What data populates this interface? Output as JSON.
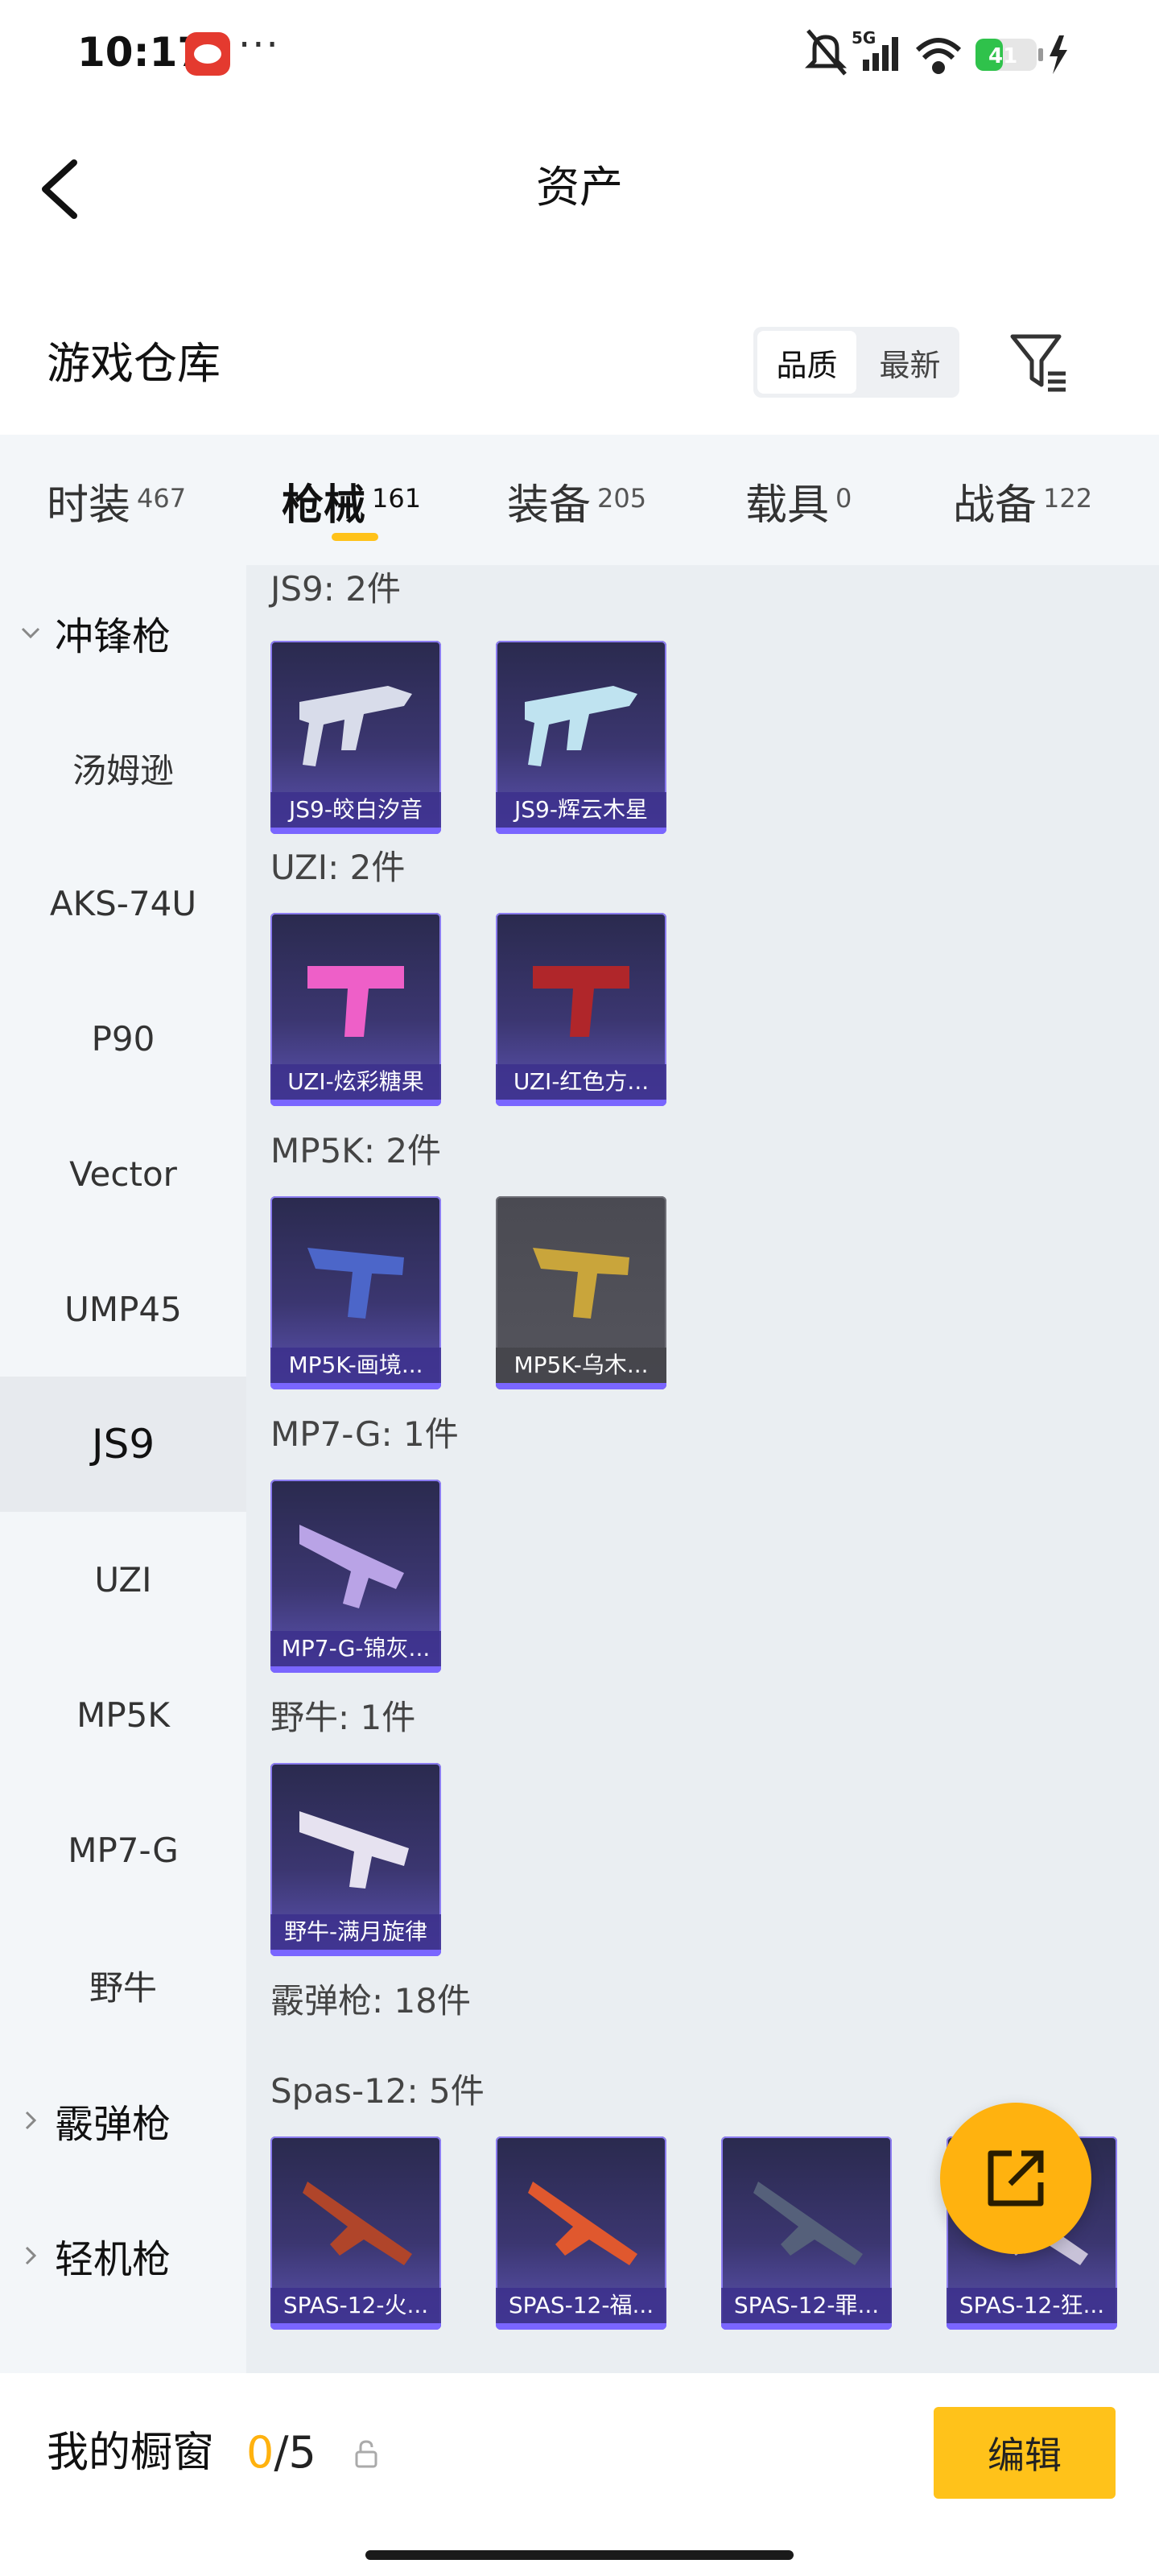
{
  "status_bar": {
    "time": "10:17",
    "more": "···",
    "battery": "41",
    "network": "5G"
  },
  "nav": {
    "title": "资产"
  },
  "warehouse": {
    "title": "游戏仓库",
    "sort_options": [
      "品质",
      "最新"
    ],
    "sort_selected": "品质"
  },
  "tabs": [
    {
      "label": "时装",
      "count": "467"
    },
    {
      "label": "枪械",
      "count": "161",
      "active": true
    },
    {
      "label": "装备",
      "count": "205"
    },
    {
      "label": "载具",
      "count": "0"
    },
    {
      "label": "战备",
      "count": "122"
    }
  ],
  "sidebar": {
    "group_open": "冲锋枪",
    "items": [
      "汤姆逊",
      "AKS-74U",
      "P90",
      "Vector",
      "UMP45",
      "JS9",
      "UZI",
      "MP5K",
      "MP7-G",
      "野牛"
    ],
    "active": "JS9",
    "collapsed_groups": [
      "霰弹枪",
      "轻机枪"
    ]
  },
  "content": {
    "groups": [
      {
        "title": "JS9: 2件",
        "cards": [
          "JS9-皎白汐音",
          "JS9-辉云木星"
        ]
      },
      {
        "title": "UZI: 2件",
        "cards": [
          "UZI-炫彩糖果",
          "UZI-红色方..."
        ]
      },
      {
        "title": "MP5K: 2件",
        "cards": [
          "MP5K-画境...",
          "MP5K-乌木..."
        ]
      },
      {
        "title": "MP7-G: 1件",
        "cards": [
          "MP7-G-锦灰..."
        ]
      },
      {
        "title": "野牛: 1件",
        "cards": [
          "野牛-满月旋律"
        ]
      },
      {
        "title": "霰弹枪: 18件",
        "cards": []
      },
      {
        "title": "Spas-12: 5件",
        "cards": [
          "SPAS-12-火...",
          "SPAS-12-福...",
          "SPAS-12-罪...",
          "SPAS-12-狂..."
        ]
      }
    ]
  },
  "bottom": {
    "showcase_label": "我的橱窗",
    "showcase_current": "0",
    "showcase_sep": "/5",
    "edit_label": "编辑"
  },
  "colors": {
    "accent": "#ffc21a",
    "fab": "#ffb20f",
    "card_purple": "#3b3670",
    "card_border": "#8b7cf0"
  },
  "icons": [
    "back-arrow-icon",
    "filter-icon",
    "chevron-down-icon",
    "chevron-right-icon",
    "share-out-icon",
    "lock-icon"
  ]
}
